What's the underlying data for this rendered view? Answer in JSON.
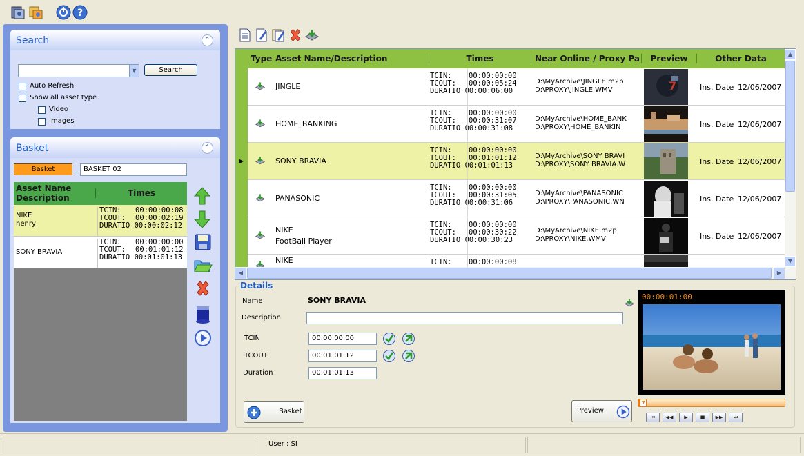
{
  "toolbar": {
    "icons": [
      "assets-icon",
      "settings-icon",
      "power-icon",
      "help-icon"
    ]
  },
  "search": {
    "title": "Search",
    "button": "Search",
    "auto_refresh": "Auto Refresh",
    "show_all": "Show all asset type",
    "video": "Video",
    "images": "Images"
  },
  "basket": {
    "title": "Basket",
    "button": "Basket",
    "name_value": "BASKET 02",
    "col_name": "Asset Name Description",
    "col_times": "Times",
    "rows": [
      {
        "name": "NIKE",
        "desc": "henry",
        "tcin": "TCIN:",
        "tcin_v": "00:00:00:08",
        "tcout": "TCOUT:",
        "tcout_v": "00:00:02:19",
        "dur": "DURATIO",
        "dur_v": "00:00:02:12"
      },
      {
        "name": "SONY BRAVIA",
        "desc": "",
        "tcin": "TCIN:",
        "tcin_v": "00:00:00:00",
        "tcout": "TCOUT:",
        "tcout_v": "00:01:01:12",
        "dur": "DURATIO",
        "dur_v": "00:01:01:13"
      }
    ]
  },
  "grid": {
    "col_type": "Type",
    "col_name": "Asset Name/Description",
    "col_times": "Times",
    "col_path": "Near Online / Proxy Pa",
    "col_preview": "Preview",
    "col_other": "Other Data",
    "rows": [
      {
        "name": "JINGLE",
        "desc": "",
        "tcin": "TCIN:",
        "tcin_v": "00:00:00:00",
        "tcout": "TCOUT:",
        "tcout_v": "00:00:05:24",
        "dur": "DURATIO",
        "dur_v": "00:00:06:00",
        "path1": "D:\\MyArchive\\JINGLE.m2p",
        "path2": "D:\\PROXY\\JINGLE.WMV",
        "ins": "Ins. Date",
        "date": "12/06/2007"
      },
      {
        "name": "HOME_BANKING",
        "desc": "",
        "tcin": "TCIN:",
        "tcin_v": "00:00:00:00",
        "tcout": "TCOUT:",
        "tcout_v": "00:00:31:07",
        "dur": "DURATIO",
        "dur_v": "00:00:31:08",
        "path1": "D:\\MyArchive\\HOME_BANK",
        "path2": "D:\\PROXY\\HOME_BANKIN",
        "ins": "Ins. Date",
        "date": "12/06/2007"
      },
      {
        "name": "SONY BRAVIA",
        "desc": "",
        "tcin": "TCIN:",
        "tcin_v": "00:00:00:00",
        "tcout": "TCOUT:",
        "tcout_v": "00:01:01:12",
        "dur": "DURATIO",
        "dur_v": "00:01:01:13",
        "path1": "D:\\MyArchive\\SONY BRAVI",
        "path2": "D:\\PROXY\\SONY BRAVIA.W",
        "ins": "Ins. Date",
        "date": "12/06/2007"
      },
      {
        "name": "PANASONIC",
        "desc": "",
        "tcin": "TCIN:",
        "tcin_v": "00:00:00:00",
        "tcout": "TCOUT:",
        "tcout_v": "00:00:31:05",
        "dur": "DURATIO",
        "dur_v": "00:00:31:06",
        "path1": "D:\\MyArchive\\PANASONIC",
        "path2": "D:\\PROXY\\PANASONIC.WN",
        "ins": "Ins. Date",
        "date": "12/06/2007"
      },
      {
        "name": "NIKE",
        "desc": "FootBall Player",
        "tcin": "TCIN:",
        "tcin_v": "00:00:00:00",
        "tcout": "TCOUT:",
        "tcout_v": "00:00:30:22",
        "dur": "DURATIO",
        "dur_v": "00:00:30:23",
        "path1": "D:\\MyArchive\\NIKE.m2p",
        "path2": "D:\\PROXY\\NIKE.WMV",
        "ins": "Ins. Date",
        "date": "12/06/2007"
      },
      {
        "name": "NIKE",
        "desc": "",
        "tcin": "TCIN:",
        "tcin_v": "00:00:00:08",
        "tcout": "",
        "tcout_v": "",
        "dur": "",
        "dur_v": "",
        "path1": "",
        "path2": "",
        "ins": "",
        "date": ""
      }
    ]
  },
  "details": {
    "title": "Details",
    "name_label": "Name",
    "name_value": "SONY BRAVIA",
    "desc_label": "Description",
    "desc_value": "",
    "tcin_label": "TCIN",
    "tcin_value": "00:00:00:00",
    "tcout_label": "TCOUT",
    "tcout_value": "00:01:01:12",
    "dur_label": "Duration",
    "dur_value": "00:01:01:13",
    "basket_button": "Basket",
    "preview_button": "Preview"
  },
  "player": {
    "timecode": "00:00:01:00",
    "progress": 0.03
  },
  "status": {
    "user": "User : SI"
  }
}
